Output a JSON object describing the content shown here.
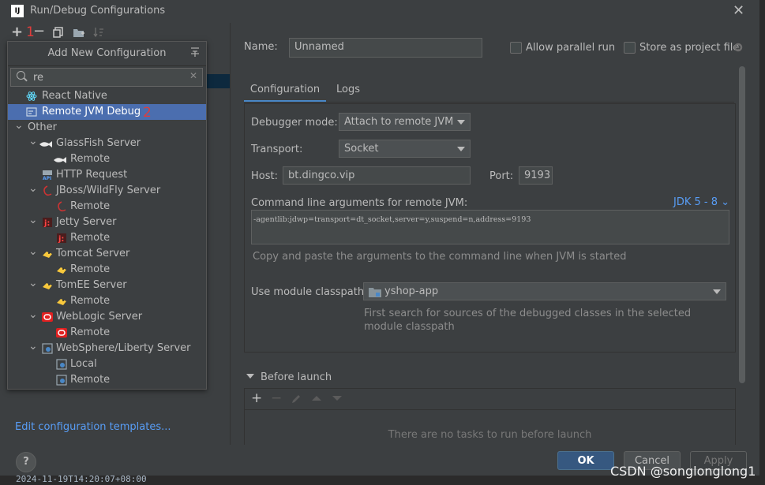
{
  "window": {
    "title": "Run/Debug Configurations",
    "logo_text": "IJ"
  },
  "left_toolbar": {
    "add_icon": "+",
    "remove_icon": "−",
    "annotation_1": "1",
    "copy_icon": "copy-icon",
    "folder_icon": "folder-add-icon",
    "sort_icon": "sort-icon"
  },
  "popup": {
    "header": "Add New Configuration",
    "search_value": "re",
    "annotation_2": "2",
    "items": [
      {
        "label": "React Native",
        "level": 0,
        "selected": false,
        "expand": ""
      },
      {
        "label": "Remote JVM Debug",
        "level": 0,
        "selected": true,
        "expand": ""
      },
      {
        "label": "Other",
        "level": 0,
        "selected": false,
        "expand": "▾"
      },
      {
        "label": "GlassFish Server",
        "level": 1,
        "selected": false,
        "expand": "▾"
      },
      {
        "label": "Remote",
        "level": 2,
        "selected": false,
        "expand": ""
      },
      {
        "label": "HTTP Request",
        "level": 1,
        "selected": false,
        "expand": ""
      },
      {
        "label": "JBoss/WildFly Server",
        "level": 1,
        "selected": false,
        "expand": "▾"
      },
      {
        "label": "Remote",
        "level": 2,
        "selected": false,
        "expand": ""
      },
      {
        "label": "Jetty Server",
        "level": 1,
        "selected": false,
        "expand": "▾"
      },
      {
        "label": "Remote",
        "level": 2,
        "selected": false,
        "expand": ""
      },
      {
        "label": "Tomcat Server",
        "level": 1,
        "selected": false,
        "expand": "▾"
      },
      {
        "label": "Remote",
        "level": 2,
        "selected": false,
        "expand": ""
      },
      {
        "label": "TomEE Server",
        "level": 1,
        "selected": false,
        "expand": "▾"
      },
      {
        "label": "Remote",
        "level": 2,
        "selected": false,
        "expand": ""
      },
      {
        "label": "WebLogic Server",
        "level": 1,
        "selected": false,
        "expand": "▾"
      },
      {
        "label": "Remote",
        "level": 2,
        "selected": false,
        "expand": ""
      },
      {
        "label": "WebSphere/Liberty Server",
        "level": 1,
        "selected": false,
        "expand": "▾"
      },
      {
        "label": "Local",
        "level": 2,
        "selected": false,
        "expand": ""
      },
      {
        "label": "Remote",
        "level": 2,
        "selected": false,
        "expand": ""
      }
    ]
  },
  "edit_templates_link": "Edit configuration templates...",
  "form": {
    "name_label": "Name:",
    "name_value": "Unnamed",
    "allow_parallel": "Allow parallel run",
    "store_as_project": "Store as project file",
    "tabs": [
      "Configuration",
      "Logs"
    ],
    "debugger_mode_label": "Debugger mode:",
    "debugger_mode_value": "Attach to remote JVM",
    "transport_label": "Transport:",
    "transport_value": "Socket",
    "host_label": "Host:",
    "host_value": "bt.dingco.vip",
    "port_label": "Port:",
    "port_value": "9193",
    "cmd_label": "Command line arguments for remote JVM:",
    "jdk_link": "JDK 5 - 8",
    "cmd_value": "-agentlib:jdwp=transport=dt_socket,server=y,suspend=n,address=9193",
    "cmd_hint": "Copy and paste the arguments to the command line when JVM is started",
    "module_label": "Use module classpath:",
    "module_value": "yshop-app",
    "module_hint_1": "First search for sources of the debugged classes in the selected",
    "module_hint_2": "module classpath",
    "before_launch": "Before launch",
    "no_tasks": "There are no tasks to run before launch"
  },
  "buttons": {
    "help": "?",
    "ok": "OK",
    "cancel": "Cancel",
    "apply": "Apply"
  },
  "status_line": "2024-11-19T14:20:07+08:00",
  "watermark": "CSDN @songlonglong1",
  "colors": {
    "selection": "#4b6eaf",
    "link": "#589df6",
    "annotation": "#e03c3c",
    "ok_button": "#365880"
  }
}
